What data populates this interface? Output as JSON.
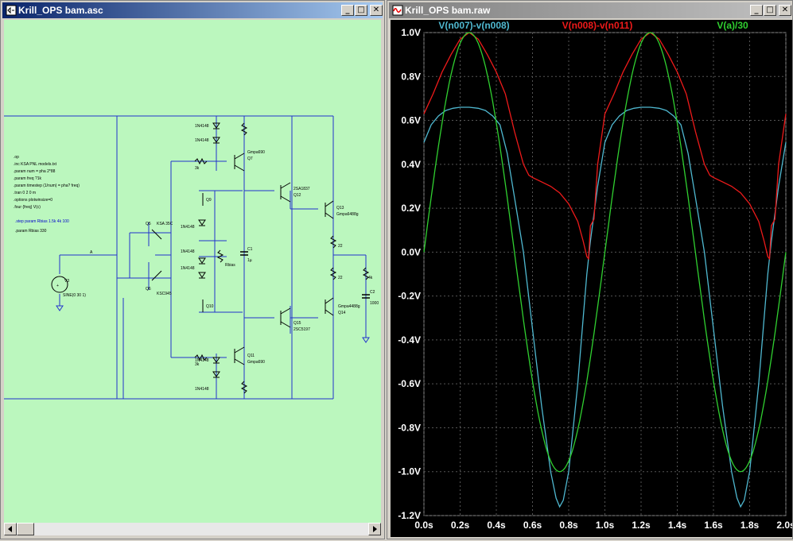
{
  "schematic_window": {
    "title": "Krill_OPS bam.asc",
    "directives": [
      ".op",
      ".inc KSA PNL models.txt",
      ".param num = pha 2*88",
      ".param freq ?1k",
      ".param timestep (1/num) = pha? freq)",
      ".tran 0 2 0 m",
      ".options plotwinsize=0",
      ".four {freq} V(c)"
    ],
    "step_directive": ".step param Rbias 1.5k 4k 100",
    "bias_directive": ".param Rbias 330",
    "components": {
      "v3_name": "V3",
      "v3_value": "SINE(0 30 1)",
      "node_a": "A",
      "q5": "Q5",
      "q5_model": "KSA 35C",
      "q6": "Q6",
      "q6_model": "KSC945",
      "q7": "Q7",
      "q7_model": "Gmpa690",
      "q9": "Q9",
      "q10": "Q10",
      "q11": "Q11",
      "q11_model": "Gmpa690",
      "q12": "Q12",
      "q12_model": "2SA1837",
      "q13": "Q13",
      "q13_model": "Gmpa6488g",
      "q14": "Q14",
      "q14_model": "Gmpa4488g",
      "q15": "Q15",
      "q15_model": "2SA1943",
      "q16": "Q16",
      "q16_model": "2SC5197",
      "diode_model": "1N4148",
      "r_small": "22",
      "r_3k": "3k",
      "r_bias": "Rbias",
      "r_4k": "4k",
      "c1": "C1",
      "c1_value": "1µ",
      "c2": "C2",
      "c2_value": "1000"
    }
  },
  "waveform_window": {
    "title": "Krill_OPS bam.raw"
  },
  "window_buttons": {
    "minimize": "_",
    "maximize": "□",
    "close": "✕"
  },
  "colors": {
    "schematic_bg": "#bbf7be",
    "wire": "#2233cc",
    "plot_bg": "#000000",
    "grid": "#555555",
    "trace_cyan": "#4fb8d0",
    "trace_red": "#ee1a1a",
    "trace_green": "#30d030",
    "title_active": "#0a246a"
  },
  "chart_data": {
    "type": "line",
    "title": "",
    "xlabel": "",
    "ylabel": "",
    "xlim": [
      0,
      2
    ],
    "ylim": [
      -1.2,
      1.0
    ],
    "x_ticks": [
      "0.0s",
      "0.2s",
      "0.4s",
      "0.6s",
      "0.8s",
      "1.0s",
      "1.2s",
      "1.4s",
      "1.6s",
      "1.8s",
      "2.0s"
    ],
    "y_ticks": [
      "1.0V",
      "0.8V",
      "0.6V",
      "0.4V",
      "0.2V",
      "0.0V",
      "-0.2V",
      "-0.4V",
      "-0.6V",
      "-0.8V",
      "-1.0V",
      "-1.2V"
    ],
    "grid": true,
    "legend_placement": "top",
    "series": [
      {
        "name": "V(n007)-v(n008)",
        "color": "#4fb8d0",
        "x": [
          0.0,
          0.04,
          0.08,
          0.12,
          0.16,
          0.2,
          0.25,
          0.3,
          0.34,
          0.38,
          0.42,
          0.46,
          0.5,
          0.55,
          0.6,
          0.65,
          0.7,
          0.73,
          0.75,
          0.77,
          0.8,
          0.85,
          0.88,
          0.9,
          0.92,
          0.96,
          1.0,
          1.04,
          1.08,
          1.12,
          1.16,
          1.2,
          1.25,
          1.3,
          1.34,
          1.38,
          1.42,
          1.46,
          1.5,
          1.55,
          1.6,
          1.65,
          1.7,
          1.73,
          1.75,
          1.77,
          1.8,
          1.85,
          1.88,
          1.9,
          1.92,
          1.96,
          2.0
        ],
        "y": [
          0.5,
          0.58,
          0.62,
          0.645,
          0.655,
          0.66,
          0.66,
          0.655,
          0.645,
          0.62,
          0.58,
          0.45,
          0.25,
          0.0,
          -0.35,
          -0.7,
          -1.0,
          -1.12,
          -1.16,
          -1.13,
          -1.0,
          -0.6,
          -0.3,
          -0.1,
          0.05,
          0.3,
          0.5,
          0.58,
          0.62,
          0.645,
          0.655,
          0.66,
          0.66,
          0.655,
          0.645,
          0.62,
          0.58,
          0.45,
          0.25,
          0.0,
          -0.35,
          -0.7,
          -1.0,
          -1.12,
          -1.16,
          -1.13,
          -1.0,
          -0.6,
          -0.3,
          -0.1,
          0.05,
          0.3,
          0.5
        ]
      },
      {
        "name": "V(n008)-v(n011)",
        "color": "#ee1a1a",
        "x": [
          0.0,
          0.05,
          0.1,
          0.15,
          0.2,
          0.25,
          0.3,
          0.35,
          0.4,
          0.45,
          0.5,
          0.55,
          0.58,
          0.6,
          0.65,
          0.7,
          0.75,
          0.8,
          0.85,
          0.88,
          0.9,
          0.91,
          0.92,
          0.94,
          0.96,
          1.0,
          1.05,
          1.1,
          1.15,
          1.2,
          1.25,
          1.3,
          1.35,
          1.4,
          1.45,
          1.5,
          1.55,
          1.58,
          1.6,
          1.65,
          1.7,
          1.75,
          1.8,
          1.85,
          1.88,
          1.9,
          1.91,
          1.92,
          1.94,
          1.96,
          2.0
        ],
        "y": [
          0.63,
          0.72,
          0.82,
          0.9,
          0.97,
          1.0,
          0.97,
          0.9,
          0.82,
          0.72,
          0.55,
          0.4,
          0.35,
          0.34,
          0.32,
          0.3,
          0.27,
          0.22,
          0.14,
          0.05,
          -0.02,
          -0.03,
          0.12,
          0.15,
          0.4,
          0.63,
          0.72,
          0.82,
          0.9,
          0.97,
          1.0,
          0.97,
          0.9,
          0.82,
          0.72,
          0.55,
          0.4,
          0.35,
          0.34,
          0.32,
          0.3,
          0.27,
          0.22,
          0.14,
          0.05,
          -0.02,
          -0.03,
          0.12,
          0.15,
          0.4,
          0.63
        ]
      },
      {
        "name": "V(a)/30",
        "color": "#30d030",
        "function": "sin(2*pi*x)",
        "x_step": 0.01
      }
    ]
  }
}
